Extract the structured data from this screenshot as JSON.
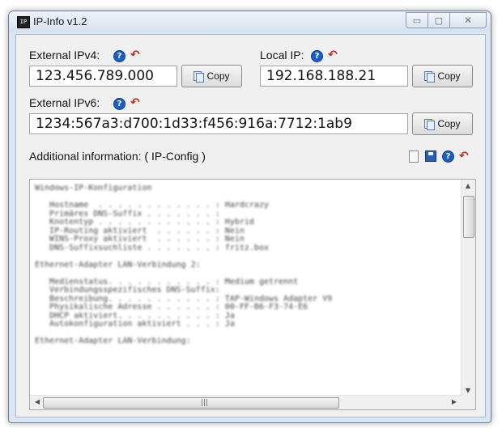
{
  "window": {
    "title": "IP-Info v1.2",
    "app_icon_text": "IP"
  },
  "window_buttons": {
    "minimize": "▭",
    "maximize": "▢",
    "close": "✕"
  },
  "external_ipv4": {
    "label": "External IPv4:",
    "value": "123.456.789.000",
    "copy_label": "Copy"
  },
  "local_ip": {
    "label": "Local IP:",
    "value": "192.168.188.21",
    "copy_label": "Copy"
  },
  "external_ipv6": {
    "label": "External IPv6:",
    "value": "1234:567a3:d700:1d33:f456:916a:7712:1ab9",
    "copy_label": "Copy"
  },
  "additional": {
    "label": "Additional information: ( IP-Config )",
    "lines": [
      "Windows-IP-Konfiguration",
      "",
      "   Hostname  . . . . . . . . . . . . : Hardcrazy",
      "   Primäres DNS-Suffix . . . . . . . :",
      "   Knotentyp . . . . . . . . . . . . : Hybrid",
      "   IP-Routing aktiviert  . . . . . . : Nein",
      "   WINS-Proxy aktiviert  . . . . . . : Nein",
      "   DNS-Suffixsuchliste . . . . . . . : fritz.box",
      "",
      "Ethernet-Adapter LAN-Verbindung 2:",
      "",
      "   Medienstatus. . . . . . . . . . . : Medium getrennt",
      "   Verbindungsspezifisches DNS-Suffix:",
      "   Beschreibung. . . . . . . . . . . : TAP-Windows Adapter V9",
      "   Physikalische Adresse . . . . . . : 00-FF-B6-F3-74-E6",
      "   DHCP aktiviert. . . . . . . . . . : Ja",
      "   Autokonfiguration aktiviert . . . : Ja",
      "",
      "Ethernet-Adapter LAN-Verbindung:"
    ]
  },
  "icons": {
    "help": "?",
    "refresh": "↶"
  },
  "scrollbar": {
    "up": "▲",
    "down": "▼",
    "left": "◀",
    "right": "▶",
    "grip": "|||"
  },
  "colors": {
    "help_icon": "#1c5fbf",
    "refresh_icon": "#c02a1c",
    "save_icon": "#2b5fae"
  }
}
